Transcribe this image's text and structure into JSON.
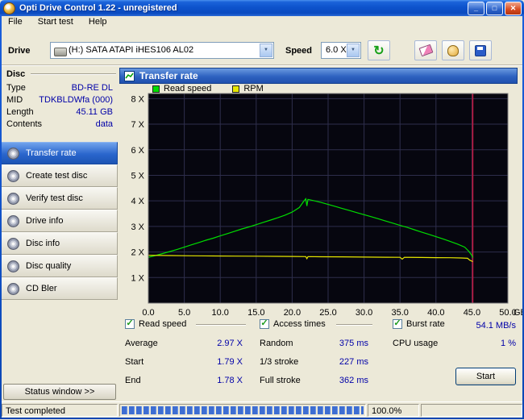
{
  "window": {
    "title": "Opti Drive Control 1.22 - unregistered",
    "icons": {
      "minimize": "_",
      "maximize": "□",
      "close": "✕",
      "check": "✓",
      "combo_arrow": "▼",
      "refresh": "↻"
    }
  },
  "menu": [
    "File",
    "Start test",
    "Help"
  ],
  "toolbar": {
    "drive_label": "Drive",
    "drive_value": "(H:)  SATA ATAPI  iHES106 AL02",
    "speed_label": "Speed",
    "speed_value": "6.0 X"
  },
  "disc_panel": {
    "title": "Disc",
    "rows": [
      {
        "label": "Type",
        "value": "BD-RE DL"
      },
      {
        "label": "MID",
        "value": "TDKBLDWfa (000)"
      },
      {
        "label": "Length",
        "value": "45.11 GB"
      },
      {
        "label": "Contents",
        "value": "data"
      }
    ]
  },
  "sidebar": {
    "items": [
      {
        "label": "Transfer rate",
        "active": true
      },
      {
        "label": "Create test disc",
        "active": false
      },
      {
        "label": "Verify test disc",
        "active": false
      },
      {
        "label": "Drive info",
        "active": false
      },
      {
        "label": "Disc info",
        "active": false
      },
      {
        "label": "Disc quality",
        "active": false
      },
      {
        "label": "CD Bler",
        "active": false
      }
    ],
    "status_window_button": "Status window >>"
  },
  "main": {
    "header": "Transfer rate"
  },
  "chart_data": {
    "type": "line",
    "title": "Transfer rate",
    "x_unit": "GB",
    "xlim": [
      0,
      50
    ],
    "ylim": [
      0,
      8.2
    ],
    "plot_bg": "#06060f",
    "plot_border": "#7b7b7b",
    "grid_color": "#2e2e4c",
    "end_marker": 45.11,
    "end_marker_color": "#c01840",
    "xticks": [
      {
        "value": 0,
        "label": "0.0"
      },
      {
        "value": 5,
        "label": "5.0"
      },
      {
        "value": 10,
        "label": "10.0"
      },
      {
        "value": 15,
        "label": "15.0"
      },
      {
        "value": 20,
        "label": "20.0"
      },
      {
        "value": 25,
        "label": "25.0"
      },
      {
        "value": 30,
        "label": "30.0"
      },
      {
        "value": 35,
        "label": "35.0"
      },
      {
        "value": 40,
        "label": "40.0"
      },
      {
        "value": 45,
        "label": "45.0"
      },
      {
        "value": 50,
        "label": "50.0"
      }
    ],
    "yticks": [
      {
        "value": 1,
        "label": "1 X"
      },
      {
        "value": 2,
        "label": "2 X"
      },
      {
        "value": 3,
        "label": "3 X"
      },
      {
        "value": 4,
        "label": "4 X"
      },
      {
        "value": 5,
        "label": "5 X"
      },
      {
        "value": 6,
        "label": "6 X"
      },
      {
        "value": 7,
        "label": "7 X"
      },
      {
        "value": 8,
        "label": "8 X"
      }
    ],
    "series": [
      {
        "name": "Read speed",
        "color": "#00dd00",
        "points": [
          [
            0,
            1.79
          ],
          [
            1,
            1.86
          ],
          [
            2,
            1.94
          ],
          [
            3,
            2.02
          ],
          [
            4,
            2.1
          ],
          [
            5,
            2.19
          ],
          [
            6,
            2.28
          ],
          [
            7,
            2.37
          ],
          [
            8,
            2.46
          ],
          [
            9,
            2.54
          ],
          [
            10,
            2.63
          ],
          [
            11,
            2.72
          ],
          [
            12,
            2.81
          ],
          [
            13,
            2.9
          ],
          [
            14,
            2.98
          ],
          [
            15,
            3.07
          ],
          [
            16,
            3.16
          ],
          [
            17,
            3.25
          ],
          [
            18,
            3.34
          ],
          [
            19,
            3.44
          ],
          [
            20,
            3.56
          ],
          [
            21,
            3.74
          ],
          [
            21.6,
            3.98
          ],
          [
            21.9,
            4.08
          ],
          [
            22.05,
            3.8
          ],
          [
            22.2,
            4.06
          ],
          [
            23,
            4.01
          ],
          [
            24,
            3.94
          ],
          [
            25,
            3.86
          ],
          [
            26,
            3.78
          ],
          [
            27,
            3.7
          ],
          [
            28,
            3.62
          ],
          [
            29,
            3.54
          ],
          [
            30,
            3.46
          ],
          [
            31,
            3.38
          ],
          [
            32,
            3.3
          ],
          [
            33,
            3.21
          ],
          [
            34,
            3.13
          ],
          [
            35,
            3.04
          ],
          [
            36,
            2.96
          ],
          [
            37,
            2.87
          ],
          [
            38,
            2.78
          ],
          [
            39,
            2.69
          ],
          [
            40,
            2.6
          ],
          [
            41,
            2.51
          ],
          [
            42,
            2.41
          ],
          [
            43,
            2.31
          ],
          [
            44,
            2.19
          ],
          [
            44.6,
            2.02
          ],
          [
            45.0,
            1.86
          ],
          [
            45.11,
            1.78
          ]
        ]
      },
      {
        "name": "RPM",
        "color": "#e6e600",
        "points": [
          [
            0,
            1.87
          ],
          [
            3,
            1.86
          ],
          [
            6,
            1.85
          ],
          [
            9,
            1.845
          ],
          [
            12,
            1.84
          ],
          [
            15,
            1.835
          ],
          [
            18,
            1.83
          ],
          [
            20,
            1.825
          ],
          [
            21.9,
            1.82
          ],
          [
            22.05,
            1.74
          ],
          [
            22.2,
            1.82
          ],
          [
            24,
            1.815
          ],
          [
            27,
            1.81
          ],
          [
            30,
            1.8
          ],
          [
            33,
            1.795
          ],
          [
            35,
            1.79
          ],
          [
            35.3,
            1.72
          ],
          [
            35.6,
            1.79
          ],
          [
            38,
            1.785
          ],
          [
            40,
            1.78
          ],
          [
            42,
            1.775
          ],
          [
            43.5,
            1.765
          ],
          [
            44.4,
            1.755
          ],
          [
            44.7,
            1.68
          ],
          [
            45.0,
            1.64
          ],
          [
            45.11,
            1.62
          ]
        ]
      }
    ]
  },
  "results": {
    "read_speed": {
      "checkbox_label": "Read speed",
      "checked": true,
      "rows": [
        {
          "label": "Average",
          "value": "2.97 X"
        },
        {
          "label": "Start",
          "value": "1.79 X"
        },
        {
          "label": "End",
          "value": "1.78 X"
        }
      ]
    },
    "access_times": {
      "checkbox_label": "Access times",
      "checked": true,
      "rows": [
        {
          "label": "Random",
          "value": "375 ms"
        },
        {
          "label": "1/3 stroke",
          "value": "227 ms"
        },
        {
          "label": "Full stroke",
          "value": "362 ms"
        }
      ]
    },
    "burst_rate": {
      "checkbox_label": "Burst rate",
      "checked": true,
      "value": "54.1 MB/s",
      "rows": [
        {
          "label": "CPU usage",
          "value": "1 %"
        }
      ]
    },
    "start_button": "Start"
  },
  "statusbar": {
    "status": "Test completed",
    "progress_label": "100.0%",
    "progress_percent": 100,
    "progress_width": "100%"
  }
}
